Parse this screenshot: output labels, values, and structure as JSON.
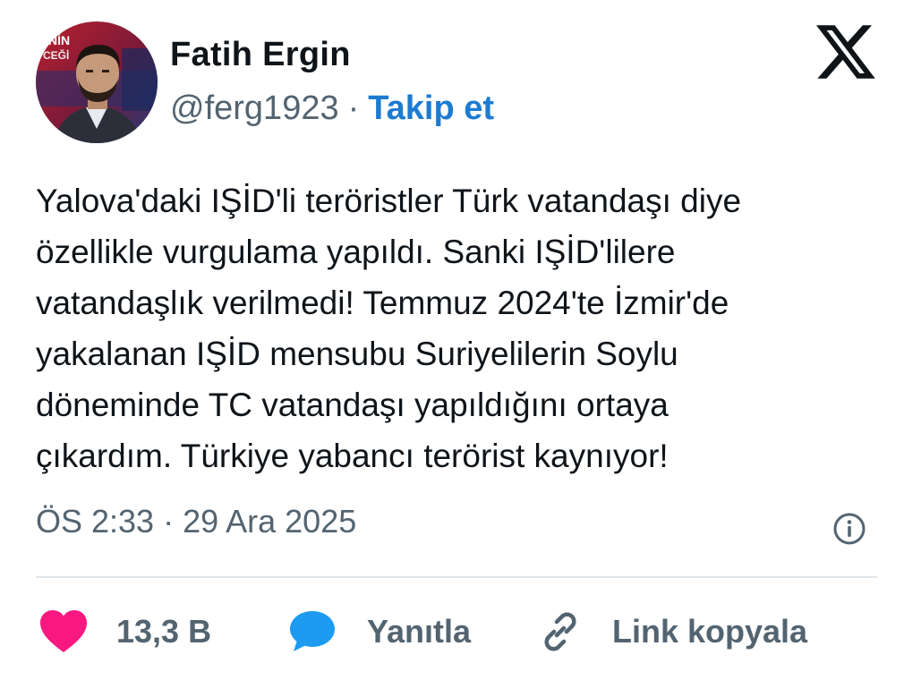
{
  "author": {
    "name": "Fatih Ergin",
    "handle": "@ferg1923",
    "separator": "·",
    "follow_label": "Takip et",
    "avatar_overlay_text": "NİN\nCEĞİ"
  },
  "platform_logo": "x-logo-icon",
  "tweet": {
    "lines": [
      "Yalova'daki IŞİD'li teröristler Türk vatandaşı diye",
      "özellikle vurgulama yapıldı. Sanki IŞİD'lilere",
      "vatandaşlık verilmedi! Temmuz 2024'te İzmir'de",
      "yakalanan IŞİD mensubu Suriyelilerin Soylu",
      "döneminde TC vatandaşı yapıldığını ortaya",
      "çıkardım. Türkiye yabancı terörist kaynıyor!"
    ],
    "timestamp": "ÖS 2:33 · 29 Ara 2025"
  },
  "actions": {
    "like_count": "13,3 B",
    "reply_label": "Yanıtla",
    "copy_link_label": "Link kopyala"
  },
  "colors": {
    "link_blue": "#1d7bd0",
    "heart_pink": "#f91880",
    "reply_blue": "#1d9bf0",
    "muted_gray": "#536471"
  }
}
